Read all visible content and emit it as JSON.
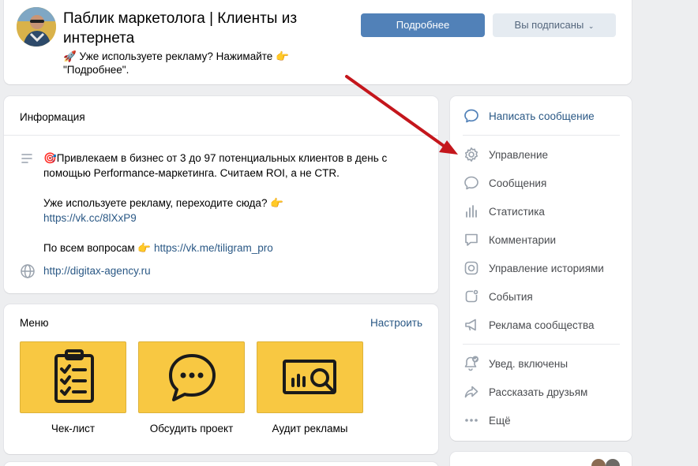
{
  "header": {
    "title": "Паблик маркетолога | Клиенты из интернета",
    "status": "🚀 Уже используете рекламу? Нажимайте 👉 \"Подробнее\".",
    "more_button": "Подробнее",
    "subscribed_button": "Вы подписаны"
  },
  "info": {
    "heading": "Информация",
    "description": [
      "🎯Привлекаем в бизнес от 3 до 97 потенциальных клиентов в день с помощью Performance-маркетинга. Считаем ROI, а не CTR."
    ],
    "ads_line": "Уже используете рекламу, переходите сюда? 👉",
    "ads_link": "https://vk.cc/8lXxP9",
    "questions_line": "По всем вопросам 👉",
    "questions_link": "https://vk.me/tiligram_pro",
    "website": "http://digitax-agency.ru"
  },
  "menu": {
    "title": "Меню",
    "configure": "Настроить",
    "items": [
      {
        "label": "Чек-лист",
        "icon": "clipboard-checklist-icon"
      },
      {
        "label": "Обсудить проект",
        "icon": "chat-bubble-icon"
      },
      {
        "label": "Аудит рекламы",
        "icon": "analytics-magnifier-icon"
      }
    ]
  },
  "actions": {
    "items": [
      {
        "label": "Написать сообщение",
        "icon": "message-icon"
      },
      {
        "label": "Управление",
        "icon": "gear-icon"
      },
      {
        "label": "Сообщения",
        "icon": "chat-icon"
      },
      {
        "label": "Статистика",
        "icon": "stats-icon"
      },
      {
        "label": "Комментарии",
        "icon": "comment-icon"
      },
      {
        "label": "Управление историями",
        "icon": "stories-icon"
      },
      {
        "label": "События",
        "icon": "events-icon"
      },
      {
        "label": "Реклама сообщества",
        "icon": "megaphone-icon"
      },
      {
        "label": "Увед. включены",
        "icon": "bell-check-icon"
      },
      {
        "label": "Рассказать друзьям",
        "icon": "share-icon"
      },
      {
        "label": "Ещё",
        "icon": "more-icon"
      }
    ]
  },
  "colors": {
    "accent": "#5181b8",
    "link": "#2a5885",
    "tile": "#f8c842",
    "arrow": "#c4161c"
  }
}
